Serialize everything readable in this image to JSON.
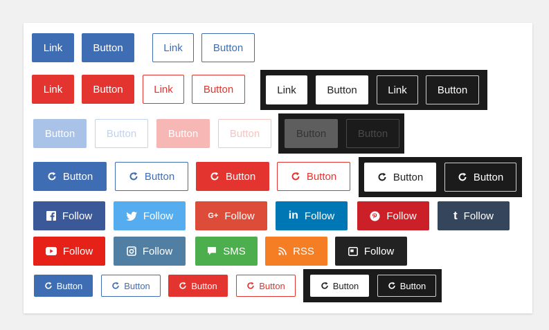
{
  "colors": {
    "primary": "#3f6db4",
    "danger": "#e3342f",
    "dark": "#1b1b1b",
    "facebook": "#3b5998",
    "twitter": "#55acee",
    "googleplus": "#dd4b39",
    "linkedin": "#0077b5",
    "pinterest": "#cb2027",
    "tumblr": "#35465c",
    "youtube": "#e62117",
    "instagram": "#517fa4",
    "sms": "#4cae4c",
    "rss": "#f57e25"
  },
  "row1": {
    "link": "Link",
    "button": "Button",
    "link_outline": "Link",
    "button_outline": "Button"
  },
  "row2": {
    "link": "Link",
    "button": "Button",
    "link_outline": "Link",
    "button_outline": "Button",
    "inverse": {
      "link": "Link",
      "button": "Button",
      "link_dark": "Link",
      "button_dark": "Button"
    }
  },
  "row3": {
    "disabled_button": "Button",
    "disabled_outline": "Button",
    "disabled_red": "Button",
    "disabled_red_outline": "Button",
    "inverse": {
      "disabled_gray": "Button",
      "disabled_dark": "Button"
    }
  },
  "row4": {
    "icon_button": "Button",
    "icon_button_outline": "Button",
    "icon_button_red": "Button",
    "icon_button_red_outline": "Button",
    "inverse": {
      "icon_button_white": "Button",
      "icon_button_dark": "Button"
    },
    "icon": "refresh-icon"
  },
  "social": {
    "facebook": {
      "label": "Follow",
      "icon": "facebook-icon"
    },
    "twitter": {
      "label": "Follow",
      "icon": "twitter-icon"
    },
    "googleplus": {
      "label": "Follow",
      "icon": "google-plus-icon",
      "glyph": "G+"
    },
    "linkedin": {
      "label": "Follow",
      "icon": "linkedin-icon",
      "glyph": "in"
    },
    "pinterest": {
      "label": "Follow",
      "icon": "pinterest-icon"
    },
    "tumblr": {
      "label": "Follow",
      "icon": "tumblr-icon",
      "glyph": "t"
    },
    "youtube": {
      "label": "Follow",
      "icon": "youtube-icon"
    },
    "instagram": {
      "label": "Follow",
      "icon": "instagram-icon"
    },
    "sms": {
      "label": "SMS",
      "icon": "chat-icon"
    },
    "rss": {
      "label": "RSS",
      "icon": "rss-icon"
    },
    "dark": {
      "label": "Follow",
      "icon": "terminal-icon"
    }
  },
  "row7": {
    "small_button": "Button",
    "small_outline": "Button",
    "small_red": "Button",
    "small_red_outline": "Button",
    "inverse": {
      "small_white": "Button",
      "small_dark": "Button"
    }
  }
}
